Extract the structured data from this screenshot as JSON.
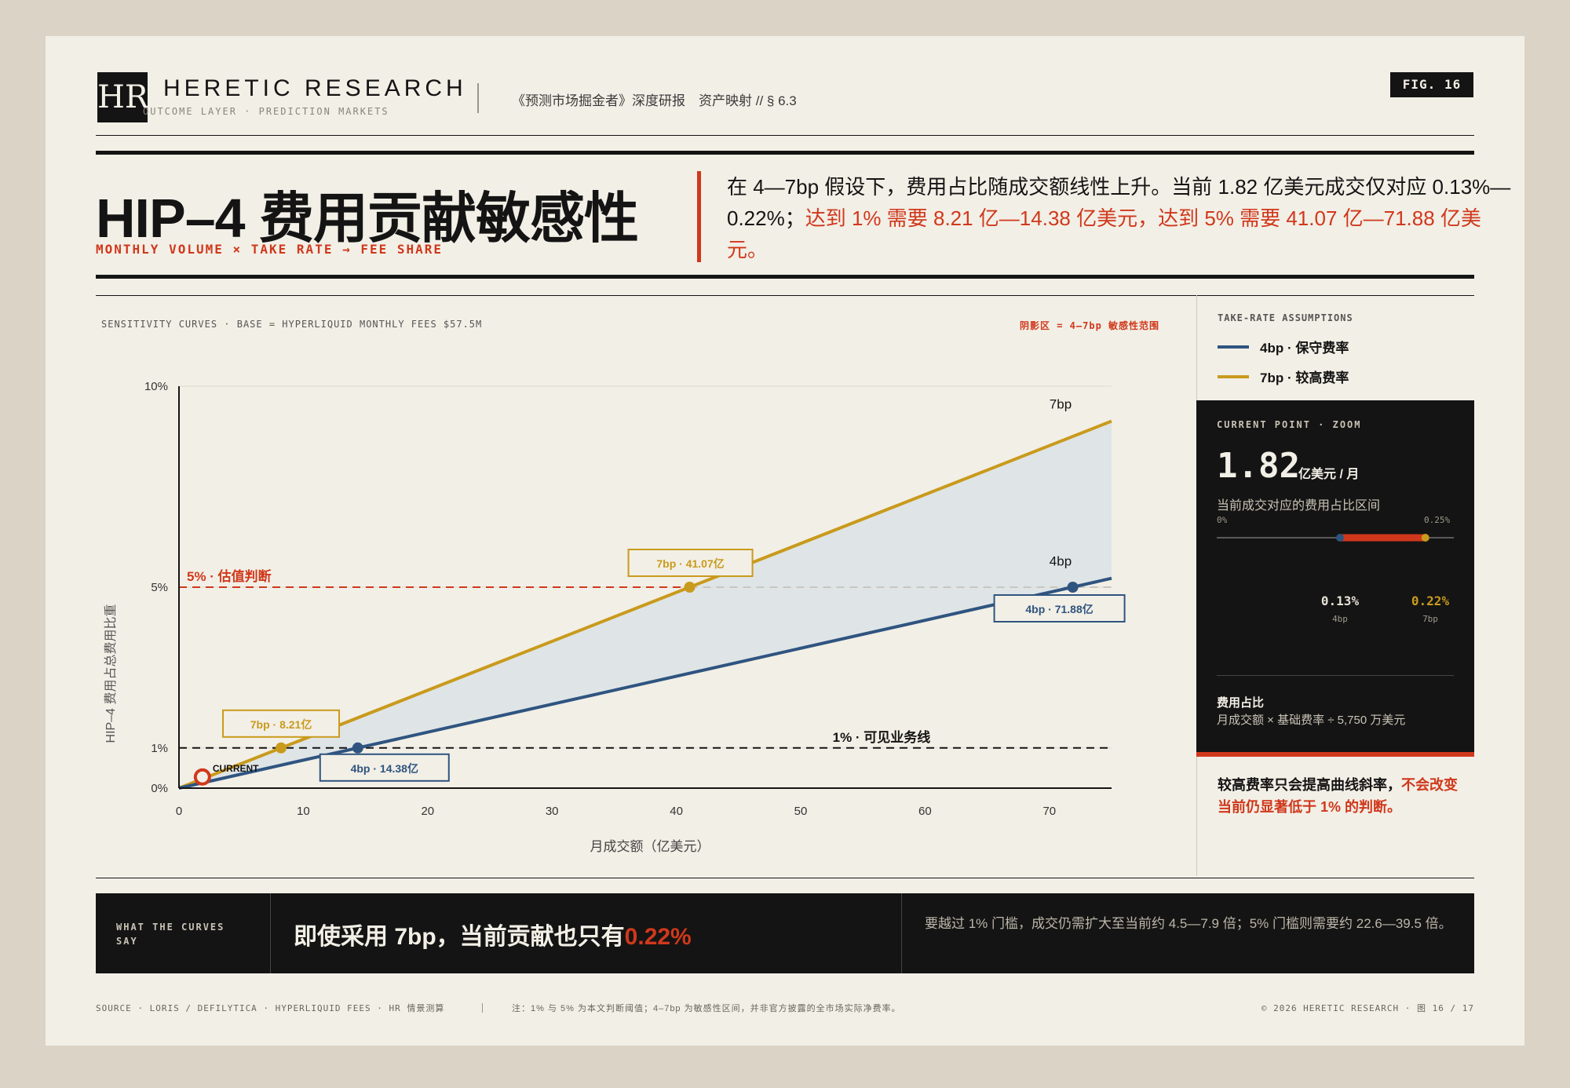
{
  "header": {
    "logo": "HR",
    "brand": "HERETIC RESEARCH",
    "brand_sub": "OUTCOME LAYER · PREDICTION MARKETS",
    "subtitle": "《预测市场掘金者》深度研报　资产映射 // § 6.3",
    "fig": "FIG. 16"
  },
  "title": {
    "main": "HIP–4 费用贡献敏感性",
    "kicker": "MONTHLY VOLUME × TAKE RATE → FEE SHARE",
    "lead_black": "在 4—7bp 假设下，费用占比随成交额线性上升。当前 1.82 亿美元成交仅对应 0.13%—0.22%；",
    "lead_red": "达到 1% 需要 8.21 亿—14.38 亿美元，达到 5% 需要 41.07 亿—71.88 亿美元。"
  },
  "chart_meta": {
    "caption": "SENSITIVITY CURVES · BASE = HYPERLIQUID MONTHLY FEES $57.5M",
    "shade_note": "阴影区 = 4–7bp 敏感性范围"
  },
  "chart_data": {
    "type": "line",
    "xlabel": "月成交额（亿美元）",
    "ylabel": "HIP–4 费用占总费用比重",
    "xlim": [
      0,
      75
    ],
    "ylim": [
      0,
      10
    ],
    "x_ticks": [
      0,
      10,
      20,
      30,
      40,
      50,
      60,
      70
    ],
    "x_tick_labels": [
      "0",
      "10",
      "20",
      "30",
      "40",
      "50",
      "60",
      "70"
    ],
    "y_ticks": [
      0,
      1,
      5,
      10
    ],
    "y_tick_labels": [
      "0%",
      "1%",
      "5%",
      "10%"
    ],
    "series": [
      {
        "name": "4bp",
        "color": "#2f5480",
        "x": [
          0,
          75
        ],
        "y": [
          0,
          5.22
        ]
      },
      {
        "name": "7bp",
        "color": "#c99a1c",
        "x": [
          0,
          75
        ],
        "y": [
          0,
          9.13
        ]
      }
    ],
    "shaded_range": "4–7bp",
    "reference_lines": [
      {
        "y": 5,
        "label": "5% · 估值判断",
        "color": "#d0381c"
      },
      {
        "y": 1,
        "label": "1% · 可见业务线",
        "color": "#141414"
      }
    ],
    "points": [
      {
        "x": 8.21,
        "y": 1,
        "label": "7bp · 8.21亿",
        "color": "#c99a1c"
      },
      {
        "x": 14.38,
        "y": 1,
        "label": "4bp · 14.38亿",
        "color": "#2f5480"
      },
      {
        "x": 41.07,
        "y": 5,
        "label": "7bp · 41.07亿",
        "color": "#c99a1c"
      },
      {
        "x": 71.88,
        "y": 5,
        "label": "4bp · 71.88亿",
        "color": "#2f5480"
      }
    ],
    "current": {
      "x": 1.82,
      "y": 0.18,
      "label": "CURRENT"
    }
  },
  "legend": {
    "title": "TAKE-RATE ASSUMPTIONS",
    "items": [
      {
        "label": "4bp · 保守费率",
        "color": "#2f5480"
      },
      {
        "label": "7bp · 较高费率",
        "color": "#c99a1c"
      }
    ]
  },
  "current_panel": {
    "title": "CURRENT POINT · ZOOM",
    "value": "1.82",
    "unit": "亿美元 / 月",
    "desc": "当前成交对应的费用占比区间",
    "scale_min": "0%",
    "scale_max": "0.25%",
    "range": {
      "low": 0.13,
      "high": 0.22,
      "max": 0.25
    },
    "low_val": "0.13%",
    "low_lab": "4bp",
    "high_val": "0.22%",
    "high_lab": "7bp",
    "fee_title": "费用占比",
    "fee_formula": "月成交额 × 基础费率 ÷ 5,750 万美元"
  },
  "note": {
    "black": "较高费率只会提高曲线斜率，",
    "red": "不会改变当前仍显著低于 1% 的判断。"
  },
  "banner": {
    "left": "WHAT THE CURVES SAY",
    "mid_black": "即使采用 7bp，当前贡献也只有",
    "mid_red": "0.22%",
    "right": "要越过 1% 门槛，成交仍需扩大至当前约 4.5—7.9 倍；5% 门槛则需要约 22.6—39.5 倍。"
  },
  "footer": {
    "source": "SOURCE · LORIS / DEFILYTICA · HYPERLIQUID FEES · HR 情景测算",
    "note": "注：1% 与 5% 为本文判断阈值；4–7bp 为敏感性区间，并非官方披露的全市场实际净费率。",
    "copyright": "© 2026 HERETIC RESEARCH · 图 16 / 17"
  }
}
